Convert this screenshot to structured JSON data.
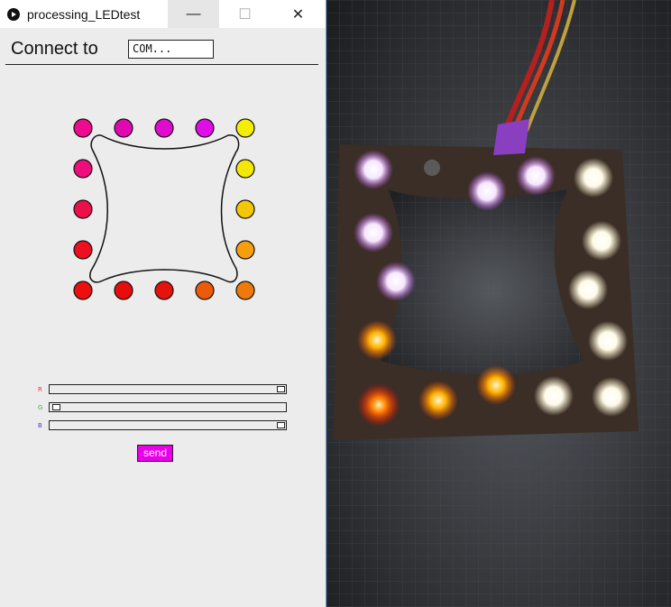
{
  "window": {
    "title": "processing_LEDtest",
    "minimize_glyph": "—",
    "maximize_glyph": "☐",
    "close_glyph": "✕"
  },
  "connect": {
    "label": "Connect to",
    "port_value": "COM..."
  },
  "led_colors": [
    "#ef0b8f",
    "#e208b1",
    "#e10bcd",
    "#e00de8",
    "#f4ee05",
    "#ee0d7a",
    "#f2e804",
    "#ec0f4a",
    "#f3c705",
    "#ed1020",
    "#f59f0c",
    "#ec0f0f",
    "#e60d0c",
    "#e4130d",
    "#ea5a09",
    "#ee7a0d"
  ],
  "sliders": [
    {
      "label": "R",
      "color": "#e04040",
      "level": 1.0
    },
    {
      "label": "G",
      "color": "#3cb43c",
      "level": 0.0
    },
    {
      "label": "B",
      "color": "#4040d0",
      "level": 1.0
    }
  ],
  "send": {
    "label": "send",
    "color": "#e800e8"
  }
}
